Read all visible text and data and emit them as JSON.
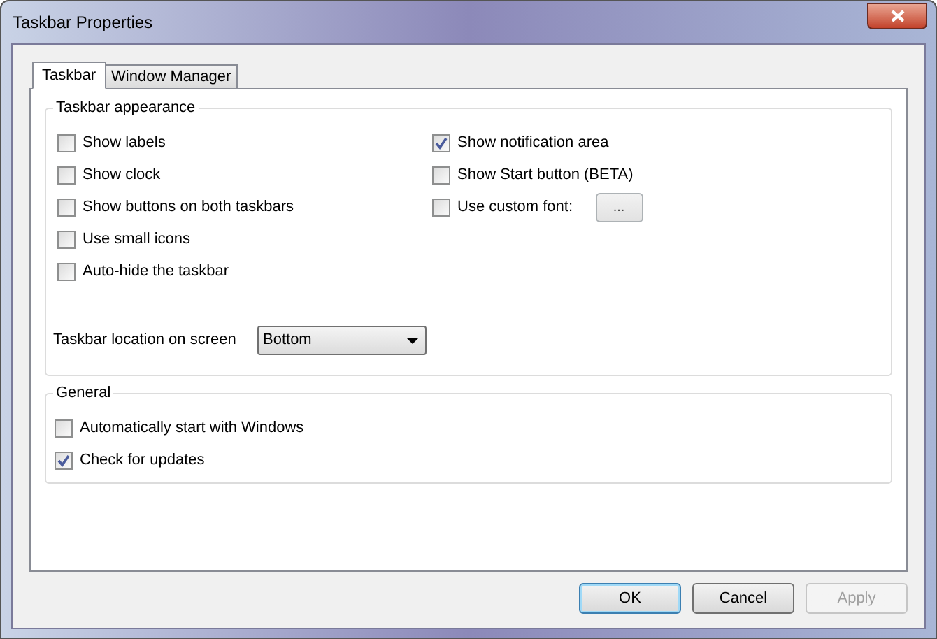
{
  "window": {
    "title": "Taskbar Properties"
  },
  "tabs": [
    {
      "label": "Taskbar",
      "selected": true
    },
    {
      "label": "Window Manager",
      "selected": false
    }
  ],
  "appearance": {
    "title": "Taskbar appearance",
    "left": [
      {
        "label": "Show labels",
        "checked": false
      },
      {
        "label": "Show clock",
        "checked": false
      },
      {
        "label": "Show buttons on both taskbars",
        "checked": false
      },
      {
        "label": "Use small icons",
        "checked": false
      },
      {
        "label": "Auto-hide the taskbar",
        "checked": false
      }
    ],
    "right": [
      {
        "label": "Show notification area",
        "checked": true
      },
      {
        "label": "Show Start button (BETA)",
        "checked": false
      },
      {
        "label": "Use custom font:",
        "checked": false,
        "button": "..."
      }
    ],
    "location": {
      "label": "Taskbar location on screen",
      "value": "Bottom"
    }
  },
  "general": {
    "title": "General",
    "options": [
      {
        "label": "Automatically start with Windows",
        "checked": false
      },
      {
        "label": "Check for updates",
        "checked": true
      }
    ]
  },
  "buttons": [
    {
      "label": "OK",
      "default": true,
      "disabled": false
    },
    {
      "label": "Cancel",
      "default": false,
      "disabled": false
    },
    {
      "label": "Apply",
      "default": false,
      "disabled": true
    }
  ]
}
